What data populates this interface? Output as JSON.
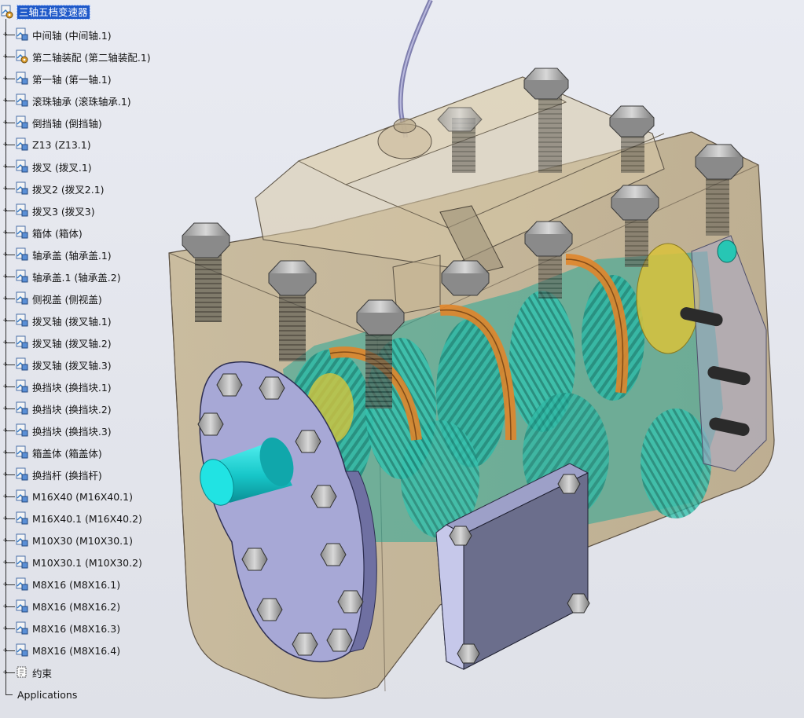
{
  "tree": {
    "root": {
      "label": "三轴五档变速器",
      "icon": "product-icon"
    },
    "nodes": [
      {
        "label": "中间轴 (中间轴.1)",
        "icon": "part-icon"
      },
      {
        "label": "第二轴装配 (第二轴装配.1)",
        "icon": "product-icon"
      },
      {
        "label": "第一轴 (第一轴.1)",
        "icon": "part-icon"
      },
      {
        "label": "滚珠轴承 (滚珠轴承.1)",
        "icon": "part-icon"
      },
      {
        "label": "倒挡轴 (倒挡轴)",
        "icon": "part-icon"
      },
      {
        "label": "Z13 (Z13.1)",
        "icon": "part-icon"
      },
      {
        "label": "拨叉 (拨叉.1)",
        "icon": "part-icon"
      },
      {
        "label": "拨叉2 (拨叉2.1)",
        "icon": "part-icon"
      },
      {
        "label": "拨叉3 (拨叉3)",
        "icon": "part-icon"
      },
      {
        "label": "箱体 (箱体)",
        "icon": "part-icon"
      },
      {
        "label": "轴承盖 (轴承盖.1)",
        "icon": "part-icon"
      },
      {
        "label": "轴承盖.1 (轴承盖.2)",
        "icon": "part-icon"
      },
      {
        "label": "侧视盖 (侧视盖)",
        "icon": "part-icon"
      },
      {
        "label": "拨叉轴 (拨叉轴.1)",
        "icon": "part-icon"
      },
      {
        "label": "拨叉轴 (拨叉轴.2)",
        "icon": "part-icon"
      },
      {
        "label": "拨叉轴 (拨叉轴.3)",
        "icon": "part-icon"
      },
      {
        "label": "换挡块 (换挡块.1)",
        "icon": "part-icon"
      },
      {
        "label": "换挡块 (换挡块.2)",
        "icon": "part-icon"
      },
      {
        "label": "换挡块 (换挡块.3)",
        "icon": "part-icon"
      },
      {
        "label": "箱盖体 (箱盖体)",
        "icon": "part-icon"
      },
      {
        "label": "换挡杆 (换挡杆)",
        "icon": "part-icon"
      },
      {
        "label": "M16X40 (M16X40.1)",
        "icon": "part-icon"
      },
      {
        "label": "M16X40.1 (M16X40.2)",
        "icon": "part-icon"
      },
      {
        "label": "M10X30 (M10X30.1)",
        "icon": "part-icon"
      },
      {
        "label": "M10X30.1 (M10X30.2)",
        "icon": "part-icon"
      },
      {
        "label": "M8X16 (M8X16.1)",
        "icon": "part-icon"
      },
      {
        "label": "M8X16 (M8X16.2)",
        "icon": "part-icon"
      },
      {
        "label": "M8X16 (M8X16.3)",
        "icon": "part-icon"
      },
      {
        "label": "M8X16 (M8X16.4)",
        "icon": "part-icon"
      },
      {
        "label": "约束",
        "icon": "constraints-icon"
      }
    ],
    "applications_label": "Applications"
  },
  "colors": {
    "background": "#e6e8ef",
    "selection": "#1f59c9",
    "housing": "#c9b691",
    "gear_teal": "#2bb7a3",
    "fork_orange": "#e08a2a",
    "flange": "#a9abd8",
    "shaft_cyan": "#1fd6d6",
    "cover_plate": "#6b6e8c"
  }
}
